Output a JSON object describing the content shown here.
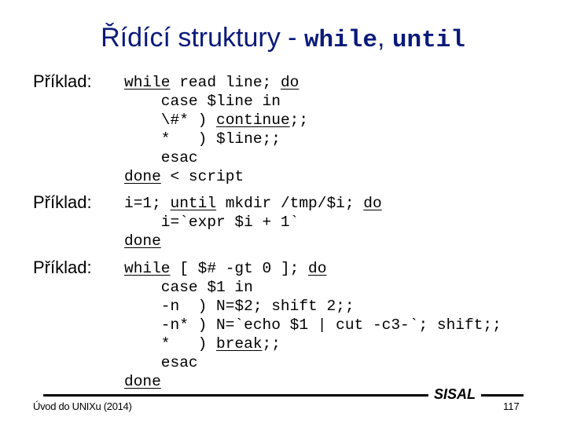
{
  "slide": {
    "title_prefix": "Řídící struktury - ",
    "title_kw1": "while",
    "title_sep": ", ",
    "title_kw2": "until"
  },
  "examples": [
    {
      "label": "Příklad:",
      "lines": [
        [
          {
            "t": "while",
            "u": true
          },
          {
            "t": " read line; "
          },
          {
            "t": "do",
            "u": true
          }
        ],
        [
          {
            "t": "    case $line in"
          }
        ],
        [
          {
            "t": "    \\#* ) "
          },
          {
            "t": "continue",
            "u": true
          },
          {
            "t": ";;"
          }
        ],
        [
          {
            "t": "    *   ) $line;;"
          }
        ],
        [
          {
            "t": "    esac"
          }
        ],
        [
          {
            "t": "done",
            "u": true
          },
          {
            "t": " < script"
          }
        ]
      ]
    },
    {
      "label": "Příklad:",
      "lines": [
        [
          {
            "t": "i=1; "
          },
          {
            "t": "until",
            "u": true
          },
          {
            "t": " mkdir /tmp/$i; "
          },
          {
            "t": "do",
            "u": true
          }
        ],
        [
          {
            "t": "    i=`expr $i + 1`"
          }
        ],
        [
          {
            "t": "done",
            "u": true
          }
        ]
      ]
    },
    {
      "label": "Příklad:",
      "lines": [
        [
          {
            "t": "while",
            "u": true
          },
          {
            "t": " [ $# -gt 0 ]; "
          },
          {
            "t": "do",
            "u": true
          }
        ],
        [
          {
            "t": "    case $1 in"
          }
        ],
        [
          {
            "t": "    -n  ) N=$2; shift 2;;"
          }
        ],
        [
          {
            "t": "    -n* ) N=`echo $1 | cut -c3-`; shift;;"
          }
        ],
        [
          {
            "t": "    *   ) "
          },
          {
            "t": "break",
            "u": true
          },
          {
            "t": ";;"
          }
        ],
        [
          {
            "t": "    esac"
          }
        ],
        [
          {
            "t": "done",
            "u": true
          }
        ]
      ]
    }
  ],
  "footer": {
    "left": "Úvod do UNIXu (2014)",
    "brand": "SISAL",
    "page": "117"
  }
}
